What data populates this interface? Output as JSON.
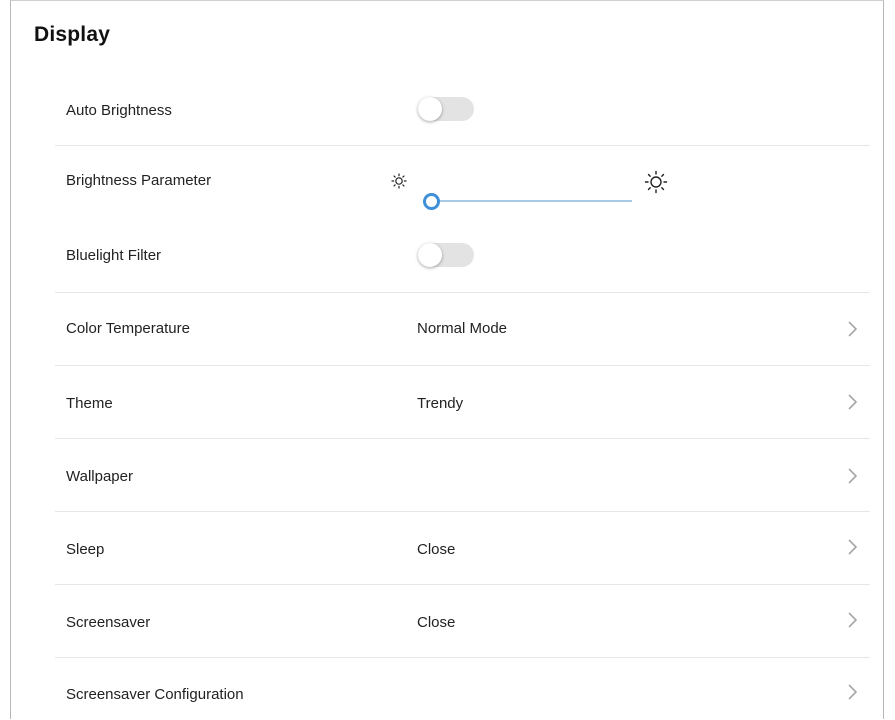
{
  "page": {
    "title": "Display"
  },
  "settings": {
    "auto_brightness": {
      "label": "Auto Brightness",
      "enabled": false
    },
    "brightness_parameter": {
      "label": "Brightness Parameter",
      "level": 0.0,
      "min_icon": "sun-small-icon",
      "max_icon": "sun-large-icon"
    },
    "bluelight_filter": {
      "label": "Bluelight Filter",
      "enabled": false
    },
    "color_temperature": {
      "label": "Color Temperature",
      "value": "Normal Mode"
    },
    "theme": {
      "label": "Theme",
      "value": "Trendy"
    },
    "wallpaper": {
      "label": "Wallpaper"
    },
    "sleep": {
      "label": "Sleep",
      "value": "Close"
    },
    "screensaver": {
      "label": "Screensaver",
      "value": "Close"
    },
    "screensaver_configuration": {
      "label": "Screensaver Configuration"
    }
  },
  "colors": {
    "accent": "#3f8fd9",
    "track": "#a9c9e6",
    "toggle_off": "#e3e3e3",
    "divider": "#e6e6e6",
    "chevron": "#a6a6a6"
  },
  "icons": {
    "chevron": "chevron-right-icon"
  }
}
